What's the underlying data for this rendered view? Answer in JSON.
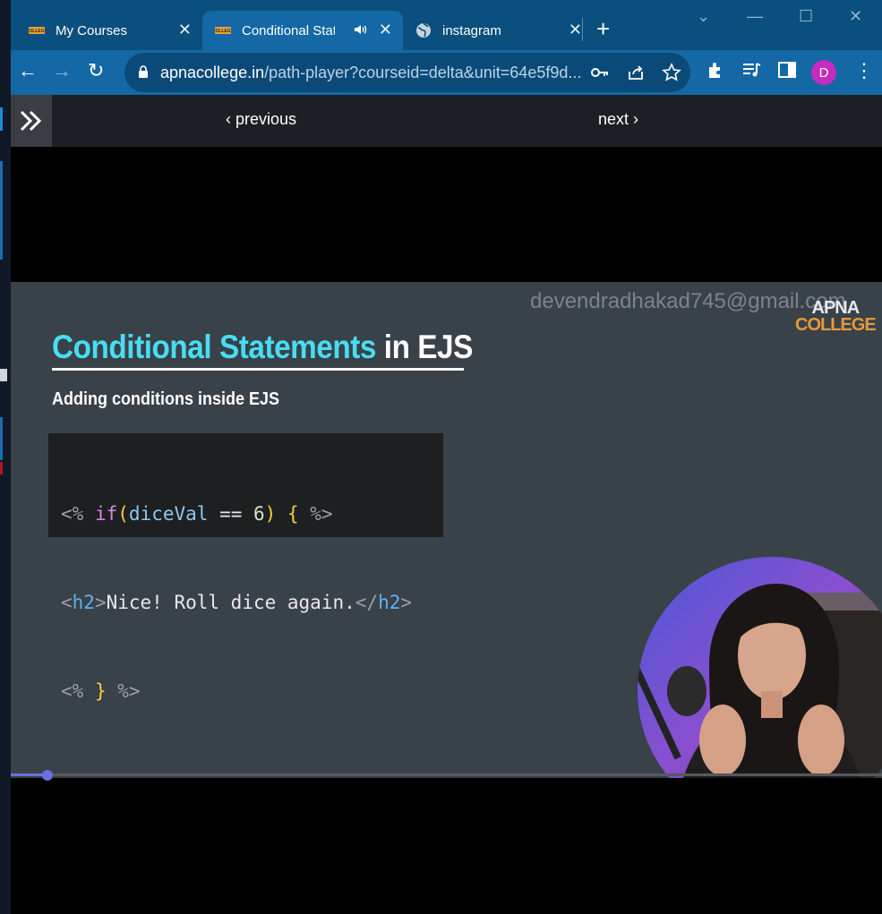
{
  "browser": {
    "tabs": [
      {
        "title": "My Courses",
        "favicon": "apna-college-favicon",
        "active": false
      },
      {
        "title": "Conditional Stat",
        "favicon": "apna-college-favicon",
        "active": true,
        "audio": true
      },
      {
        "title": "instagram",
        "favicon": "globe-icon",
        "active": false
      }
    ],
    "address": {
      "host": "apnacollege.in",
      "path": "/path-player?courseid=delta&unit=64e5f9d..."
    },
    "profile_initial": "D",
    "accent_color": "#1468a5"
  },
  "player_nav": {
    "previous_label": "previous",
    "next_label": "next"
  },
  "slide": {
    "watermark": "devendradhakad745@gmail.com",
    "logo_top": "APNA",
    "logo_bottom": "COLLEGE",
    "title_accent": "Conditional Statements",
    "title_rest": " in EJS",
    "subtitle": "Adding conditions inside EJS",
    "code_lines": [
      "<% if(diceVal == 6) { %>",
      "<h2>Nice! Roll dice again.</h2>",
      "<% } %>"
    ]
  },
  "video": {
    "progress": 0.042
  }
}
